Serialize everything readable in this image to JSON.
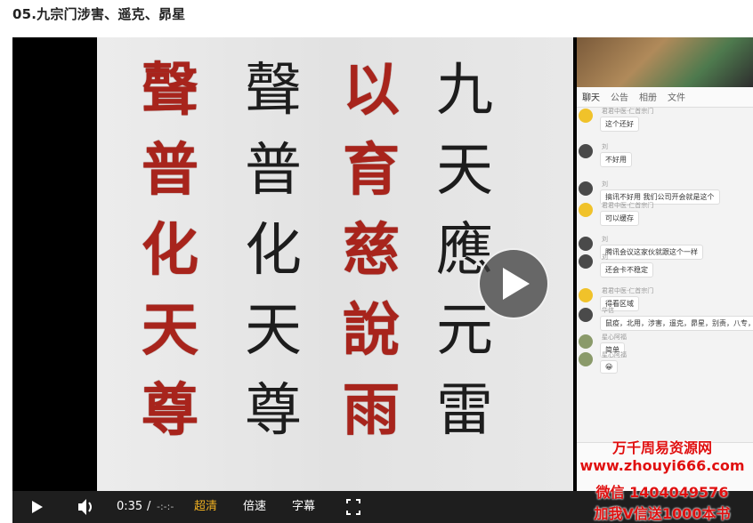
{
  "page_title": "05.九宗门涉害、遥克、昴星",
  "video": {
    "glyph_columns": [
      {
        "style": "ink",
        "chars": [
          "九",
          "天",
          "應",
          "元",
          "雷"
        ]
      },
      {
        "style": "seal",
        "chars": [
          "以",
          "育",
          "慈",
          "說",
          "雨"
        ]
      },
      {
        "style": "ink",
        "chars": [
          "聲",
          "普",
          "化",
          "天",
          "尊"
        ]
      },
      {
        "style": "seal",
        "chars": [
          "聲",
          "普",
          "化",
          "天",
          "尊"
        ]
      }
    ]
  },
  "side_panel": {
    "tabs": [
      "聊天",
      "公告",
      "相册",
      "文件"
    ],
    "messages": [
      {
        "avatar": "yellow",
        "name": "君君中医·仁首宗门",
        "text": "这个还好"
      },
      {
        "avatar": "dark",
        "name": "刘",
        "text": "不好用"
      },
      {
        "avatar": "dark",
        "name": "刘",
        "text": "搞讯不好用  我们公司开会就是这个"
      },
      {
        "avatar": "yellow",
        "name": "君君中医·仁首宗门",
        "text": "可以缓存"
      },
      {
        "avatar": "dark",
        "name": "刘",
        "text": "腾讯会议这家伙就跟这个一样"
      },
      {
        "avatar": "dark",
        "name": "刘",
        "text": "还会卡不稳定"
      },
      {
        "avatar": "yellow",
        "name": "君君中医·仁首宗门",
        "text": "得看区域"
      },
      {
        "avatar": "dark",
        "name": "华信",
        "text": "鼠疫，北用，涉害，遥克，昴星，别责，八专，伏吟"
      },
      {
        "avatar": "green",
        "name": "星心阿福",
        "text": "简单"
      },
      {
        "avatar": "green",
        "name": "星心阿福",
        "text": "😀"
      }
    ]
  },
  "controls": {
    "current_time": "0:35",
    "separator": "/",
    "duration": "-:-:-",
    "quality": "超清",
    "speed": "倍速",
    "subtitles": "字幕"
  },
  "watermark": {
    "line1": "万千周易资源网",
    "line2": "www.zhouyi666.com",
    "line3": "微信 1404049576",
    "line4": "加我V信送1000本书"
  },
  "colors": {
    "seal_red": "#a8241c",
    "quality_active": "#f0b020",
    "watermark": "#e01010"
  }
}
